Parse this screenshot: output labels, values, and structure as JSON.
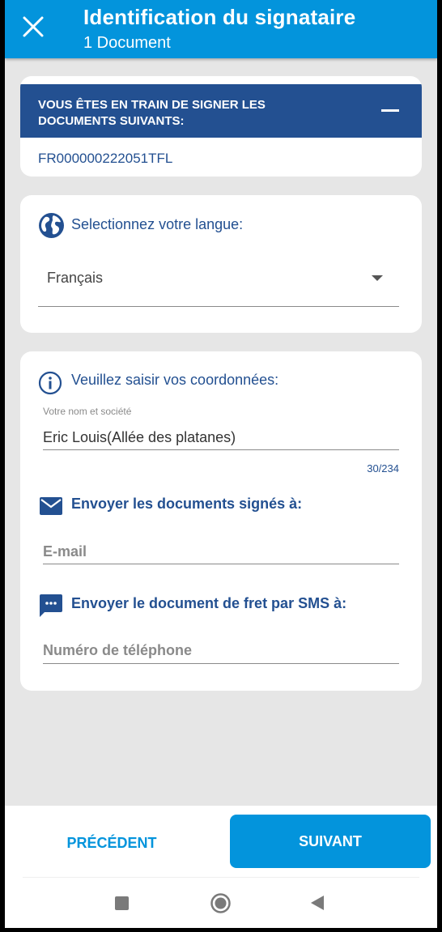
{
  "header": {
    "title": "Identification du signataire",
    "subtitle": "1 Document",
    "close_icon": "close-icon",
    "color": "#0394dc"
  },
  "documents_card": {
    "heading_line1": "VOUS ÊTES EN TRAIN DE SIGNER LES",
    "heading_line2": "DOCUMENTS SUIVANTS:",
    "collapse_icon": "minus-icon",
    "document_ref": "FR000000222051TFL",
    "header_color": "#235091"
  },
  "language_card": {
    "icon": "globe-icon",
    "label": "Selectionnez votre langue:",
    "selected": "Français"
  },
  "contact_card": {
    "icon": "info-icon",
    "label": "Veuillez saisir vos coordonnées:",
    "name_field_label": "Votre nom et société",
    "name_value": "Eric Louis(Allée des platanes)",
    "counter": "30/234",
    "email_section": {
      "icon": "envelope-icon",
      "label": "Envoyer les documents signés à:",
      "placeholder": "E-mail"
    },
    "sms_section": {
      "icon": "chat-bubble-icon",
      "label": "Envoyer le document de fret par SMS à:",
      "placeholder": "Numéro de téléphone"
    }
  },
  "footer": {
    "prev_label": "PRÉCÉDENT",
    "next_label": "SUIVANT"
  },
  "android_nav": {
    "recents": "square-icon",
    "home": "circle-icon",
    "back": "triangle-back-icon"
  }
}
